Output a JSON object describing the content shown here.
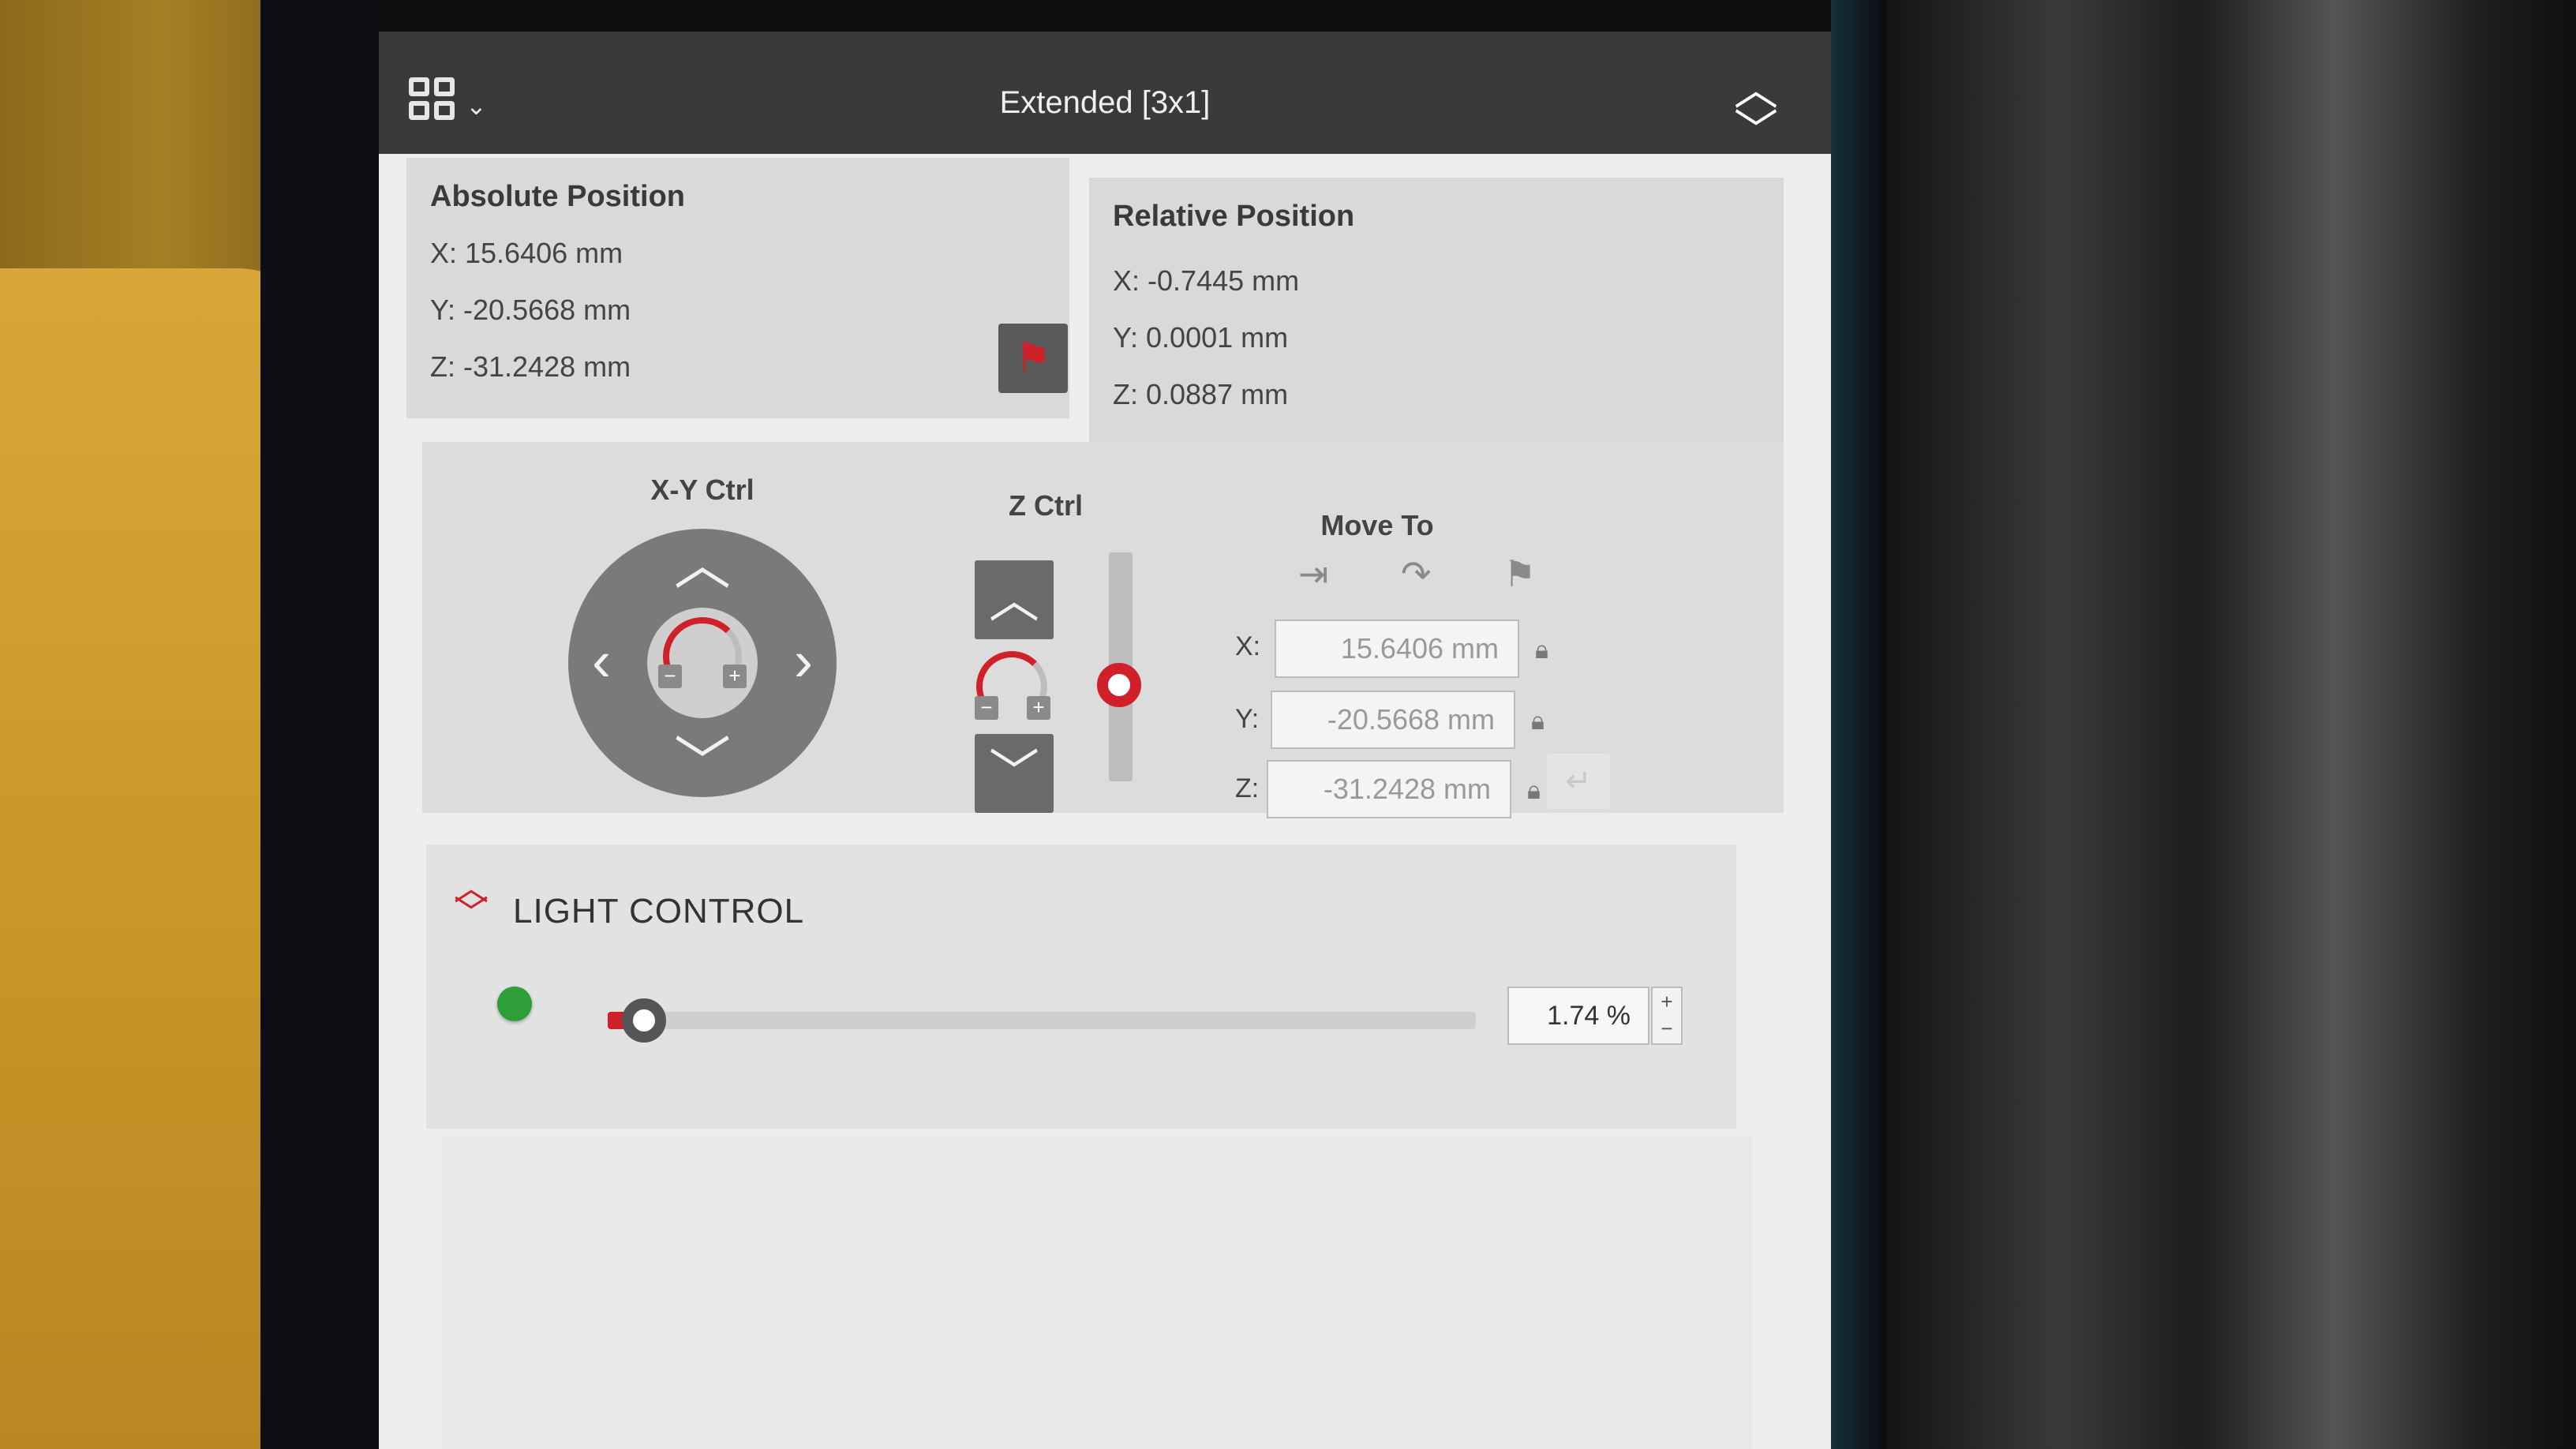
{
  "window": {
    "title": "Extended [3x1]",
    "layout_icon": "grid-layout-icon",
    "toggle_icon": "up-down-chevron-icon"
  },
  "absolute_position": {
    "title": "Absolute Position",
    "x": "X: 15.6406 mm",
    "y": "Y: -20.5668 mm",
    "z": "Z: -31.2428 mm",
    "flag_icon": "flag-icon"
  },
  "relative_position": {
    "title": "Relative Position",
    "x": "X: -0.7445 mm",
    "y": "Y: 0.0001 mm",
    "z": "Z: 0.0887 mm"
  },
  "xy_ctrl": {
    "title": "X-Y Ctrl",
    "icons": [
      "up-arrow-icon",
      "down-arrow-icon",
      "left-arrow-icon",
      "right-arrow-icon",
      "speed-dial-icon"
    ],
    "minus": "−",
    "plus": "+"
  },
  "z_ctrl": {
    "title": "Z Ctrl",
    "minus": "−",
    "plus": "+"
  },
  "move_to": {
    "title": "Move To",
    "icons": [
      "move-to-axis-icon",
      "move-arc-icon",
      "move-to-flag-icon"
    ],
    "x_label": "X:",
    "y_label": "Y:",
    "z_label": "Z:",
    "x_value": "15.6406 mm",
    "y_value": "-20.5668 mm",
    "z_value": "-31.2428 mm"
  },
  "light_control": {
    "title": "LIGHT CONTROL",
    "value": "1.74 %",
    "level_fraction": 0.0174,
    "stepper_plus": "+",
    "stepper_minus": "−",
    "status_color": "#2e9e3a"
  },
  "colors": {
    "accent": "#d0202a",
    "titlebar": "#3a3a3a",
    "panel": "#d9d9d9"
  }
}
